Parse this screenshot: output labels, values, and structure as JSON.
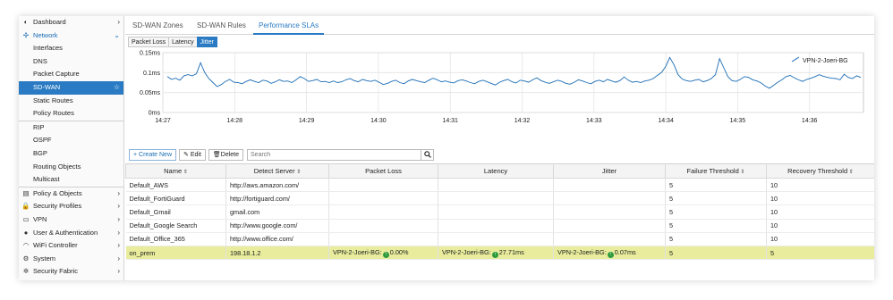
{
  "sidebar": {
    "items": [
      {
        "label": "Dashboard",
        "icon": "dashboard-icon",
        "glyph": "◐",
        "arrow": "›",
        "kind": "top"
      },
      {
        "label": "Network",
        "icon": "network-icon",
        "glyph": "✣",
        "arrow": "⌄",
        "kind": "section"
      },
      {
        "label": "Interfaces",
        "kind": "sub"
      },
      {
        "label": "DNS",
        "kind": "sub"
      },
      {
        "label": "Packet Capture",
        "kind": "sub"
      },
      {
        "label": "SD-WAN",
        "kind": "selected",
        "arrow": "☆"
      },
      {
        "label": "Static Routes",
        "kind": "sub"
      },
      {
        "label": "Policy Routes",
        "kind": "sub"
      },
      {
        "label": "RIP",
        "kind": "sub-sep"
      },
      {
        "label": "OSPF",
        "kind": "sub"
      },
      {
        "label": "BGP",
        "kind": "sub"
      },
      {
        "label": "Routing Objects",
        "kind": "sub"
      },
      {
        "label": "Multicast",
        "kind": "sub"
      },
      {
        "label": "Policy & Objects",
        "icon": "policy-objects-icon",
        "glyph": "▤",
        "arrow": "›",
        "kind": "top-sep"
      },
      {
        "label": "Security Profiles",
        "icon": "lock-icon",
        "glyph": "🔒",
        "arrow": "›",
        "kind": "top"
      },
      {
        "label": "VPN",
        "icon": "vpn-icon",
        "glyph": "▭",
        "arrow": "›",
        "kind": "top"
      },
      {
        "label": "User & Authentication",
        "icon": "user-icon",
        "glyph": "●",
        "arrow": "›",
        "kind": "top"
      },
      {
        "label": "WiFi Controller",
        "icon": "wifi-icon",
        "glyph": "◠",
        "arrow": "›",
        "kind": "top"
      },
      {
        "label": "System",
        "icon": "gear-icon",
        "glyph": "⚙",
        "arrow": "›",
        "kind": "top"
      },
      {
        "label": "Security Fabric",
        "icon": "fabric-icon",
        "glyph": "✲",
        "arrow": "›",
        "kind": "top"
      }
    ]
  },
  "tabs": [
    "SD-WAN Zones",
    "SD-WAN Rules",
    "Performance SLAs"
  ],
  "active_tab": 2,
  "subtabs": [
    "Packet Loss",
    "Latency",
    "Jitter"
  ],
  "active_subtab": 2,
  "chart_data": {
    "type": "line",
    "series": [
      {
        "name": "VPN-2-Joeri-BG",
        "color": "#1a6cb5",
        "values": [
          0.09,
          0.083,
          0.086,
          0.081,
          0.092,
          0.095,
          0.092,
          0.097,
          0.125,
          0.1,
          0.085,
          0.075,
          0.065,
          0.07,
          0.078,
          0.083,
          0.076,
          0.075,
          0.072,
          0.078,
          0.082,
          0.078,
          0.075,
          0.081,
          0.079,
          0.073,
          0.077,
          0.082,
          0.078,
          0.079,
          0.075,
          0.082,
          0.09,
          0.085,
          0.078,
          0.08,
          0.083,
          0.077,
          0.078,
          0.075,
          0.079,
          0.075,
          0.077,
          0.082,
          0.085,
          0.08,
          0.077,
          0.083,
          0.08,
          0.078,
          0.081,
          0.076,
          0.07,
          0.073,
          0.078,
          0.081,
          0.075,
          0.072,
          0.079,
          0.083,
          0.08,
          0.077,
          0.075,
          0.081,
          0.086,
          0.082,
          0.077,
          0.079,
          0.076,
          0.074,
          0.08,
          0.082,
          0.079,
          0.075,
          0.072,
          0.078,
          0.081,
          0.077,
          0.073,
          0.069,
          0.076,
          0.08,
          0.083,
          0.077,
          0.074,
          0.081,
          0.079,
          0.076,
          0.082,
          0.087,
          0.08,
          0.076,
          0.073,
          0.077,
          0.081,
          0.078,
          0.073,
          0.071,
          0.076,
          0.082,
          0.079,
          0.075,
          0.072,
          0.078,
          0.081,
          0.077,
          0.083,
          0.079,
          0.076,
          0.08,
          0.089,
          0.081,
          0.076,
          0.078,
          0.075,
          0.079,
          0.081,
          0.085,
          0.093,
          0.1,
          0.115,
          0.138,
          0.12,
          0.095,
          0.084,
          0.08,
          0.078,
          0.081,
          0.083,
          0.077,
          0.08,
          0.085,
          0.095,
          0.135,
          0.112,
          0.09,
          0.08,
          0.078,
          0.083,
          0.09,
          0.088,
          0.082,
          0.079,
          0.074,
          0.066,
          0.061,
          0.068,
          0.076,
          0.082,
          0.09,
          0.093,
          0.087,
          0.082,
          0.078,
          0.083,
          0.086,
          0.09,
          0.095,
          0.091,
          0.088,
          0.086,
          0.085,
          0.082,
          0.096,
          0.088,
          0.085,
          0.092,
          0.088
        ]
      }
    ],
    "y_ticks": [
      "0.15ms",
      "0.1ms",
      "0.05ms",
      "0ms"
    ],
    "ylim": [
      0,
      0.15
    ],
    "x_ticks": [
      "14:27",
      "14:28",
      "14:29",
      "14:30",
      "14:31",
      "14:32",
      "14:33",
      "14:34",
      "14:35",
      "14:36"
    ],
    "grid": true,
    "legend": "top-right"
  },
  "toolbar": {
    "create_label": "Create New",
    "edit_label": "Edit",
    "delete_label": "Delete",
    "search_placeholder": "Search"
  },
  "table": {
    "columns": [
      "Name",
      "Detect Server",
      "Packet Loss",
      "Latency",
      "Jitter",
      "Failure Threshold",
      "Recovery Threshold"
    ],
    "rows": [
      {
        "name": "Default_AWS",
        "server": "http://aws.amazon.com/",
        "loss": "",
        "latency": "",
        "jitter": "",
        "fail": "5",
        "recover": "10"
      },
      {
        "name": "Default_FortiGuard",
        "server": "http://fortiguard.com/",
        "loss": "",
        "latency": "",
        "jitter": "",
        "fail": "5",
        "recover": "10"
      },
      {
        "name": "Default_Gmail",
        "server": "gmail.com",
        "loss": "",
        "latency": "",
        "jitter": "",
        "fail": "5",
        "recover": "10"
      },
      {
        "name": "Default_Google Search",
        "server": "http://www.google.com/",
        "loss": "",
        "latency": "",
        "jitter": "",
        "fail": "5",
        "recover": "10"
      },
      {
        "name": "Default_Office_365",
        "server": "http://www.office.com/",
        "loss": "",
        "latency": "",
        "jitter": "",
        "fail": "5",
        "recover": "10"
      },
      {
        "name": "on_prem",
        "server": "198.18.1.2",
        "iface": "VPN-2-Joeri-BG:",
        "loss": "0.00%",
        "latency": "27.71ms",
        "jitter": "0.07ms",
        "fail": "5",
        "recover": "5",
        "highlight": true
      }
    ]
  }
}
